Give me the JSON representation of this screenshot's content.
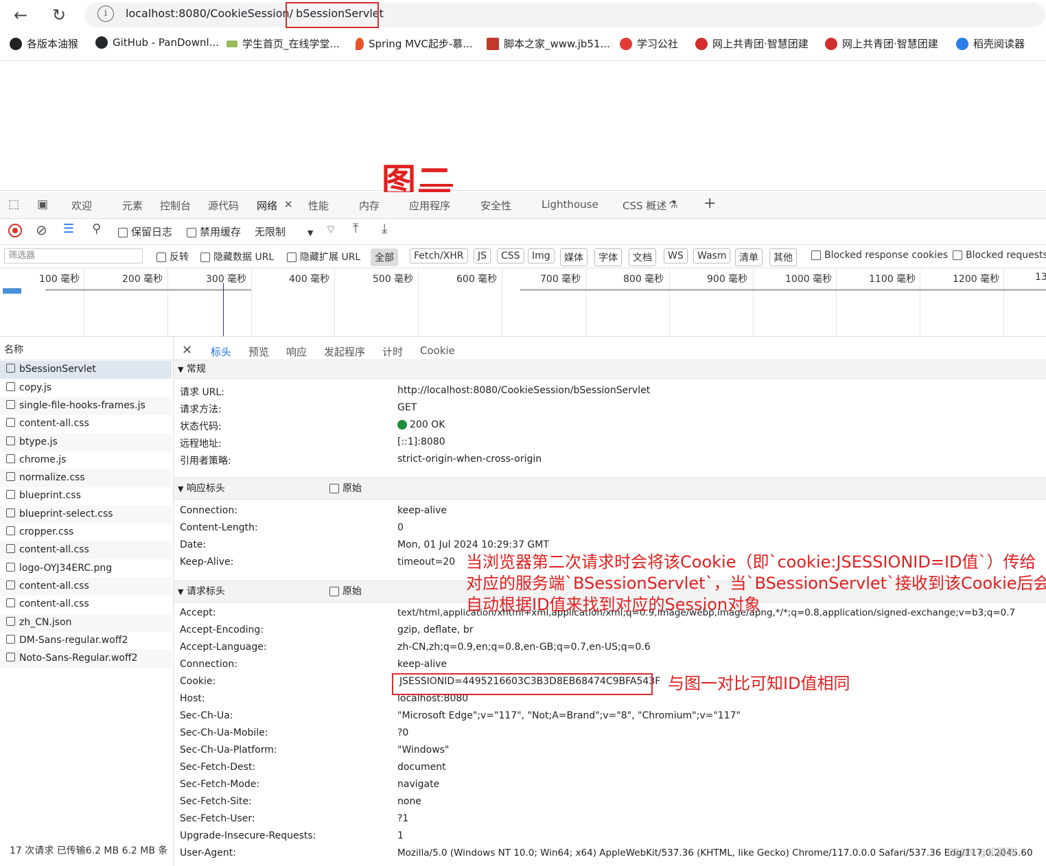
{
  "browser": {
    "url_host": "localhost:8080/CookieSession/",
    "url_path": "bSessionServlet",
    "bookmarks": [
      "各版本油猴",
      "GitHub - PanDownl...",
      "学生首页_在线学堂...",
      "Spring MVC起步-慕...",
      "脚本之家_www.jb51...",
      "学习公社",
      "网上共青团·智慧团建",
      "网上共青团·智慧团建",
      "稻壳阅读器"
    ]
  },
  "page": {
    "figure_label": "图二"
  },
  "devtools": {
    "tabs": [
      "欢迎",
      "元素",
      "控制台",
      "源代码",
      "网络",
      "性能",
      "内存",
      "应用程序",
      "安全性",
      "Lighthouse",
      "CSS 概述"
    ],
    "toolbar": {
      "preserve_log": "保留日志",
      "disable_cache": "禁用缓存",
      "throttle": "无限制"
    },
    "filter": {
      "placeholder": "筛选器",
      "invert": "反转",
      "hide_data_url": "隐藏数据 URL",
      "hide_ext_url": "隐藏扩展 URL",
      "types": [
        "全部",
        "Fetch/XHR",
        "JS",
        "CSS",
        "Img",
        "媒体",
        "字体",
        "文档",
        "WS",
        "Wasm",
        "清单",
        "其他"
      ],
      "blocked_cookies": "Blocked response cookies",
      "blocked_requests": "Blocked requests"
    },
    "timeline_ticks": [
      "100 毫秒",
      "200 毫秒",
      "300 毫秒",
      "400 毫秒",
      "500 毫秒",
      "600 毫秒",
      "700 毫秒",
      "800 毫秒",
      "900 毫秒",
      "1000 毫秒",
      "1100 毫秒",
      "1200 毫秒",
      "13"
    ],
    "request_list": {
      "header": "名称",
      "items": [
        "bSessionServlet",
        "copy.js",
        "single-file-hooks-frames.js",
        "content-all.css",
        "btype.js",
        "chrome.js",
        "normalize.css",
        "blueprint.css",
        "blueprint-select.css",
        "cropper.css",
        "content-all.css",
        "logo-OYJ34ERC.png",
        "content-all.css",
        "content-all.css",
        "zh_CN.json",
        "DM-Sans-regular.woff2",
        "Noto-Sans-Regular.woff2"
      ],
      "status": "17 次请求  已传输6.2 MB  6.2 MB 条"
    },
    "detail_tabs": [
      "标头",
      "预览",
      "响应",
      "发起程序",
      "计时",
      "Cookie"
    ],
    "general": {
      "title": "常规",
      "rows": [
        {
          "k": "请求 URL:",
          "v": "http://localhost:8080/CookieSession/bSessionServlet"
        },
        {
          "k": "请求方法:",
          "v": "GET"
        },
        {
          "k": "状态代码:",
          "v": "200 OK"
        },
        {
          "k": "远程地址:",
          "v": "[::1]:8080"
        },
        {
          "k": "引用者策略:",
          "v": "strict-origin-when-cross-origin"
        }
      ]
    },
    "response_headers": {
      "title": "响应标头",
      "raw": "原始",
      "rows": [
        {
          "k": "Connection:",
          "v": "keep-alive"
        },
        {
          "k": "Content-Length:",
          "v": "0"
        },
        {
          "k": "Date:",
          "v": "Mon, 01 Jul 2024 10:29:37 GMT"
        },
        {
          "k": "Keep-Alive:",
          "v": "timeout=20"
        }
      ]
    },
    "request_headers": {
      "title": "请求标头",
      "raw": "原始",
      "rows": [
        {
          "k": "Accept:",
          "v": "text/html,application/xhtml+xml,application/xml;q=0.9,image/webp,image/apng,*/*;q=0.8,application/signed-exchange;v=b3;q=0.7"
        },
        {
          "k": "Accept-Encoding:",
          "v": "gzip, deflate, br"
        },
        {
          "k": "Accept-Language:",
          "v": "zh-CN,zh;q=0.9,en;q=0.8,en-GB;q=0.7,en-US;q=0.6"
        },
        {
          "k": "Connection:",
          "v": "keep-alive"
        },
        {
          "k": "Cookie:",
          "v": "JSESSIONID=4495216603C3B3D8EB68474C9BFA543F"
        },
        {
          "k": "Host:",
          "v": "localhost:8080"
        },
        {
          "k": "Sec-Ch-Ua:",
          "v": "\"Microsoft Edge\";v=\"117\", \"Not;A=Brand\";v=\"8\", \"Chromium\";v=\"117\""
        },
        {
          "k": "Sec-Ch-Ua-Mobile:",
          "v": "?0"
        },
        {
          "k": "Sec-Ch-Ua-Platform:",
          "v": "\"Windows\""
        },
        {
          "k": "Sec-Fetch-Dest:",
          "v": "document"
        },
        {
          "k": "Sec-Fetch-Mode:",
          "v": "navigate"
        },
        {
          "k": "Sec-Fetch-Site:",
          "v": "none"
        },
        {
          "k": "Sec-Fetch-User:",
          "v": "?1"
        },
        {
          "k": "Upgrade-Insecure-Requests:",
          "v": "1"
        },
        {
          "k": "User-Agent:",
          "v": "Mozilla/5.0 (Windows NT 10.0; Win64; x64) AppleWebKit/537.36 (KHTML, like Gecko) Chrome/117.0.0.0 Safari/537.36 Edg/117.0.2045.60"
        }
      ]
    }
  },
  "annotations": {
    "note_line1": "当浏览器第二次请求时会将该Cookie（即`cookie:JSESSIONID=ID值`）传给",
    "note_line2": "对应的服务端`BSessionServlet`，当`BSessionServlet`接收到该Cookie后会",
    "note_line3": "自动根据ID值来找到对应的Session对象",
    "cookie_note": "与图一对比可知ID值相同"
  },
  "watermark": "CSDN @机器猫",
  "colors": {
    "annotation_red": "#e02020",
    "status_green": "#1e8e3e",
    "active_tab_blue": "#1a73e8"
  }
}
